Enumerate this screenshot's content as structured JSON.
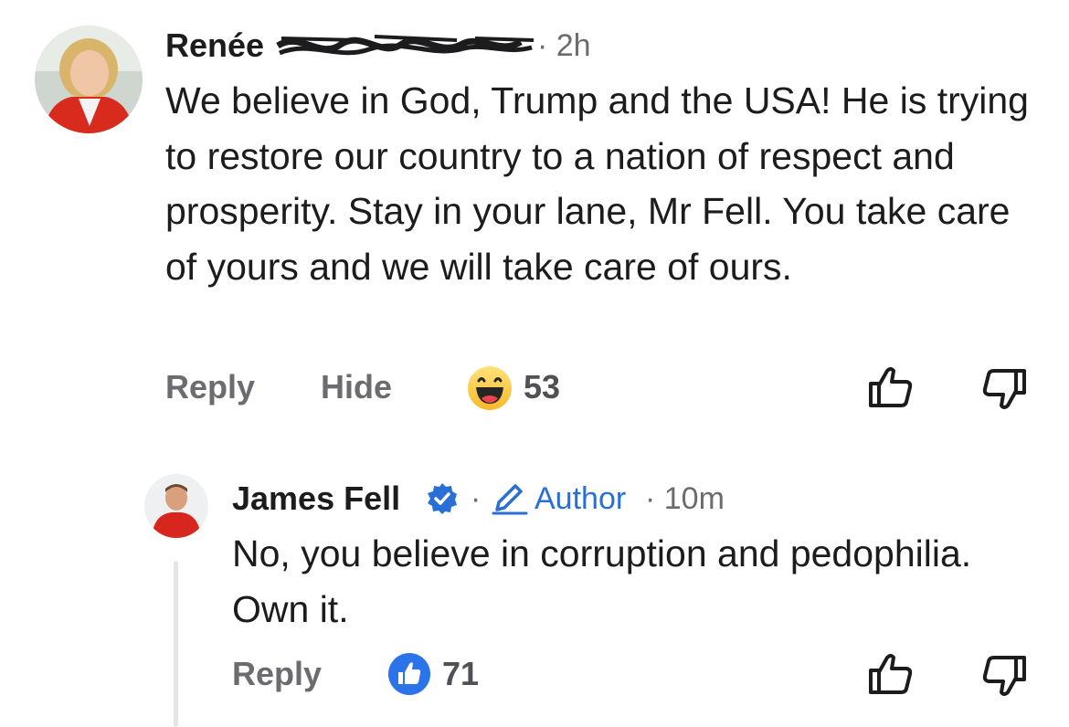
{
  "comments": [
    {
      "author": "Renée",
      "time": "· 2h",
      "text": "We believe in God, Trump and the USA! He is trying to restore our country to a nation of respect and prosperity. Stay in your lane, Mr Fell. You take care of yours and we will take care of ours.",
      "reply_label": "Reply",
      "hide_label": "Hide",
      "reaction": "haha",
      "reaction_count": "53"
    }
  ],
  "reply": {
    "author": "James Fell",
    "verified": true,
    "separator": "·",
    "author_badge": "Author",
    "time": "· 10m",
    "text": "No, you believe in corruption and pedophilia. Own it.",
    "reply_label": "Reply",
    "reaction": "like",
    "reaction_count": "71"
  },
  "colors": {
    "accent": "#2a6fd6",
    "muted": "#6b6b70",
    "text": "#1c1c1e",
    "thread_line": "#e6e6e8"
  },
  "icons": [
    "avatar",
    "redaction-scribble",
    "haha-reaction-icon",
    "thumbs-up-icon",
    "thumbs-down-icon",
    "verified-badge-icon",
    "pencil-icon",
    "like-reaction-icon"
  ]
}
